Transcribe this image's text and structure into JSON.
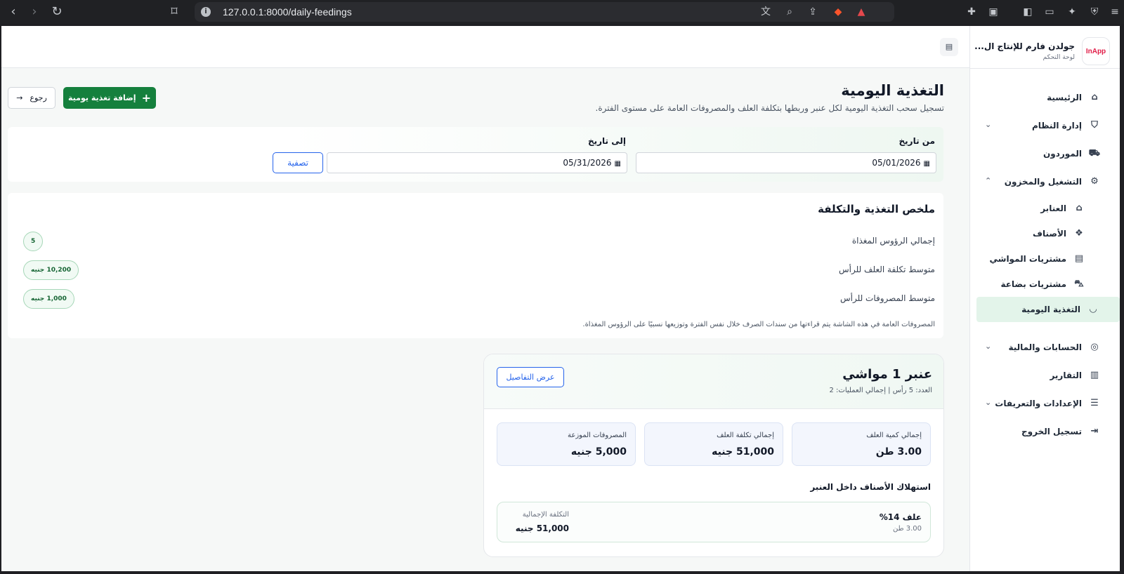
{
  "browser": {
    "url": "127.0.0.1:8000/daily-feedings"
  },
  "sidebar": {
    "brand_name": "جولدن فارم للإنتاج ال...",
    "brand_sub": "لوحة التحكم",
    "logo_text": "InApp",
    "items": [
      {
        "label": "الرئيسية",
        "icon": "home-icon"
      },
      {
        "label": "إدارة النظام",
        "icon": "shield-icon",
        "chevron": "down"
      },
      {
        "label": "الموردون",
        "icon": "truck-icon"
      },
      {
        "label": "التشغيل والمخزون",
        "icon": "tractor-icon",
        "chevron": "up"
      }
    ],
    "sub_items": [
      {
        "label": "العنابر",
        "icon": "warehouse-icon"
      },
      {
        "label": "الأصناف",
        "icon": "boxes-icon"
      },
      {
        "label": "مشتريات المواشي",
        "icon": "clipboard-icon"
      },
      {
        "label": "مشتريات بضاعة",
        "icon": "cart-icon"
      },
      {
        "label": "التغذية اليومية",
        "icon": "bowl-icon",
        "active": true
      }
    ],
    "items_bottom": [
      {
        "label": "الحسابات والمالية",
        "icon": "coins-icon",
        "chevron": "down"
      },
      {
        "label": "التقارير",
        "icon": "report-icon"
      },
      {
        "label": "الإعدادات والتعريفات",
        "icon": "sliders-icon",
        "chevron": "down"
      },
      {
        "label": "تسجيل الخروج",
        "icon": "logout-icon"
      }
    ]
  },
  "header": {
    "title": "التغذية اليومية",
    "subtitle": "تسجيل سحب التغذية اليومية لكل عنبر وربطها بتكلفة العلف والمصروفات العامة على مستوى الفترة.",
    "add_button": "إضافة تغذية يومية",
    "back_button": "رجوع"
  },
  "filter": {
    "from_label": "من تاريخ",
    "from_value": "05/01/2026",
    "to_label": "إلى تاريخ",
    "to_value": "05/31/2026",
    "button": "تصفية"
  },
  "summary": {
    "title": "ملخص التغذية والتكلفة",
    "rows": [
      {
        "label": "إجمالي الرؤوس المغذاة",
        "value": "5"
      },
      {
        "label": "متوسط تكلفة العلف للرأس",
        "value": "10,200 جنيه"
      },
      {
        "label": "متوسط المصروفات للرأس",
        "value": "1,000 جنيه"
      }
    ],
    "note": "المصروفات العامة في هذه الشاشة يتم قراءتها من سندات الصرف خلال نفس الفترة وتوزيعها نسبيًا على الرؤوس المغذاة."
  },
  "barn": {
    "title": "عنبر 1 مواشي",
    "meta": "العدد: 5 رأس | إجمالي العمليات: 2",
    "details_button": "عرض التفاصيل",
    "stats": [
      {
        "label": "إجمالي كمية العلف",
        "value": "3.00 طن"
      },
      {
        "label": "إجمالي تكلفة العلف",
        "value": "51,000 جنيه"
      },
      {
        "label": "المصروفات الموزعة",
        "value": "5,000 جنيه"
      }
    ],
    "consumption_title": "استهلاك الأصناف داخل العنبر",
    "consumption": {
      "name": "علف 14%",
      "qty": "3.00 طن",
      "cost_label": "التكلفة الإجمالية",
      "cost_value": "51,000 جنيه"
    }
  }
}
